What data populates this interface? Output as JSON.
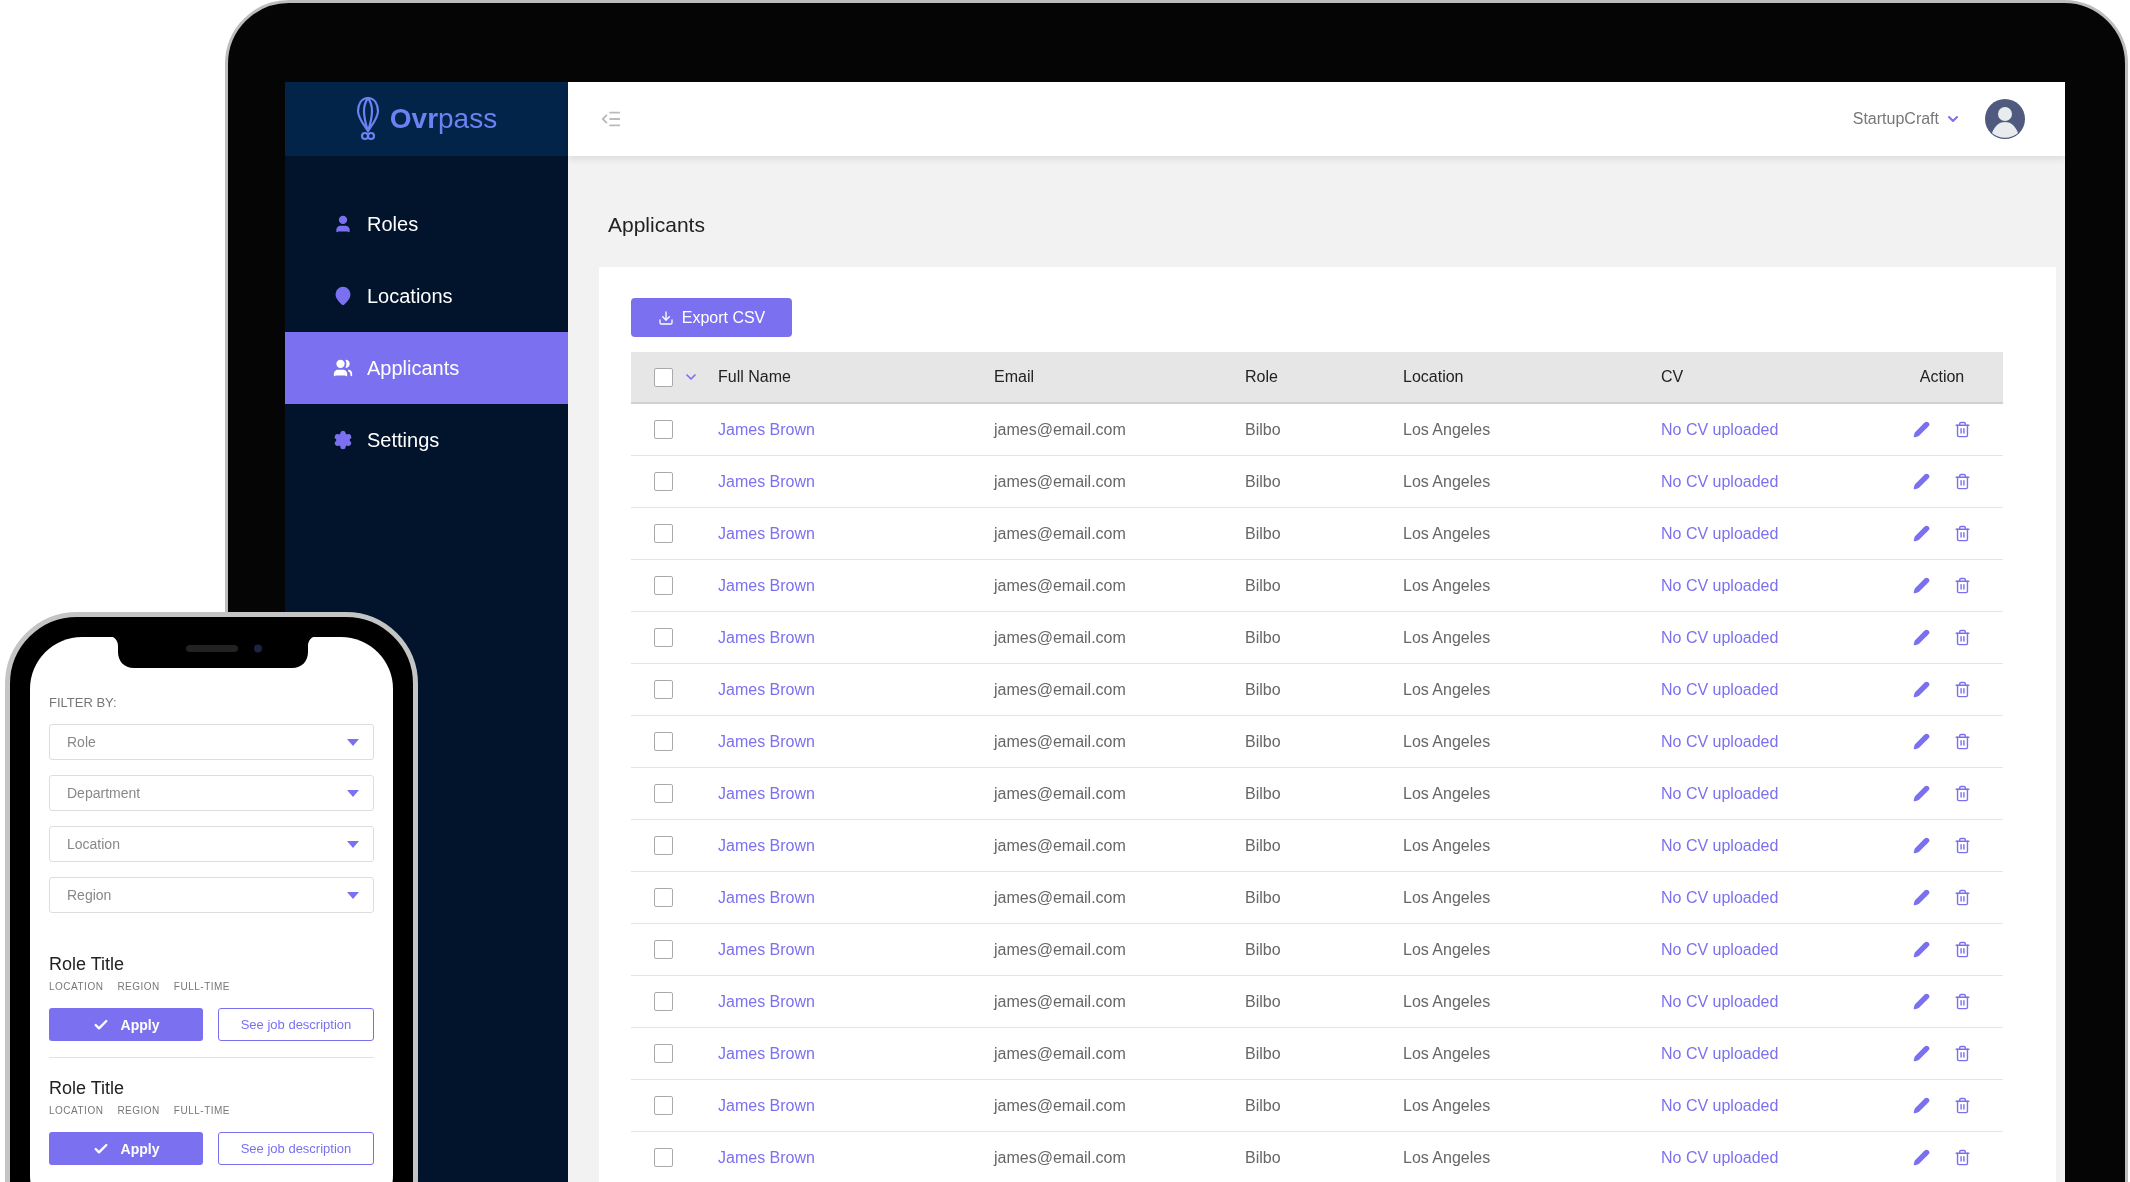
{
  "laptop": {
    "sidebar": {
      "logo": "**Ovr**pass",
      "items": [
        {
          "label": "Roles",
          "kind": "person",
          "selected": false
        },
        {
          "label": "Locations",
          "kind": "pin",
          "selected": false
        },
        {
          "label": "Applicants",
          "kind": "group",
          "selected": true
        },
        {
          "label": "Settings",
          "kind": "gear",
          "selected": false
        }
      ]
    },
    "header": {
      "account": "StartupCraft"
    },
    "page_title": "Applicants",
    "export_button": "Export CSV",
    "table": {
      "select_all_checked": false,
      "columns": [
        "Full Name",
        "Email",
        "Role",
        "Location",
        "CV",
        "Action"
      ],
      "rows": [
        {
          "name": "James Brown",
          "email": "james@email.com",
          "role": "Bilbo",
          "location": "Los Angeles",
          "cv": "No CV uploaded",
          "checked": false
        },
        {
          "name": "James Brown",
          "email": "james@email.com",
          "role": "Bilbo",
          "location": "Los Angeles",
          "cv": "No CV uploaded",
          "checked": false
        },
        {
          "name": "James Brown",
          "email": "james@email.com",
          "role": "Bilbo",
          "location": "Los Angeles",
          "cv": "No CV uploaded",
          "checked": false
        },
        {
          "name": "James Brown",
          "email": "james@email.com",
          "role": "Bilbo",
          "location": "Los Angeles",
          "cv": "No CV uploaded",
          "checked": false
        },
        {
          "name": "James Brown",
          "email": "james@email.com",
          "role": "Bilbo",
          "location": "Los Angeles",
          "cv": "No CV uploaded",
          "checked": false
        },
        {
          "name": "James Brown",
          "email": "james@email.com",
          "role": "Bilbo",
          "location": "Los Angeles",
          "cv": "No CV uploaded",
          "checked": false
        },
        {
          "name": "James Brown",
          "email": "james@email.com",
          "role": "Bilbo",
          "location": "Los Angeles",
          "cv": "No CV uploaded",
          "checked": false
        },
        {
          "name": "James Brown",
          "email": "james@email.com",
          "role": "Bilbo",
          "location": "Los Angeles",
          "cv": "No CV uploaded",
          "checked": false
        },
        {
          "name": "James Brown",
          "email": "james@email.com",
          "role": "Bilbo",
          "location": "Los Angeles",
          "cv": "No CV uploaded",
          "checked": false
        },
        {
          "name": "James Brown",
          "email": "james@email.com",
          "role": "Bilbo",
          "location": "Los Angeles",
          "cv": "No CV uploaded",
          "checked": false
        },
        {
          "name": "James Brown",
          "email": "james@email.com",
          "role": "Bilbo",
          "location": "Los Angeles",
          "cv": "No CV uploaded",
          "checked": false
        },
        {
          "name": "James Brown",
          "email": "james@email.com",
          "role": "Bilbo",
          "location": "Los Angeles",
          "cv": "No CV uploaded",
          "checked": false
        },
        {
          "name": "James Brown",
          "email": "james@email.com",
          "role": "Bilbo",
          "location": "Los Angeles",
          "cv": "No CV uploaded",
          "checked": false
        },
        {
          "name": "James Brown",
          "email": "james@email.com",
          "role": "Bilbo",
          "location": "Los Angeles",
          "cv": "No CV uploaded",
          "checked": false
        },
        {
          "name": "James Brown",
          "email": "james@email.com",
          "role": "Bilbo",
          "location": "Los Angeles",
          "cv": "No CV uploaded",
          "checked": false
        }
      ]
    }
  },
  "phone": {
    "filter_label": "FILTER BY:",
    "filters": [
      {
        "placeholder": "Role"
      },
      {
        "placeholder": "Department"
      },
      {
        "placeholder": "Location"
      },
      {
        "placeholder": "Region"
      }
    ],
    "jobs": [
      {
        "title": "Role Title",
        "tags": [
          "LOCATION",
          "REGION",
          "FULL-TIME"
        ],
        "apply": "Apply",
        "details": "See job description"
      },
      {
        "title": "Role Title",
        "tags": [
          "LOCATION",
          "REGION",
          "FULL-TIME"
        ],
        "apply": "Apply",
        "details": "See job description"
      }
    ]
  }
}
